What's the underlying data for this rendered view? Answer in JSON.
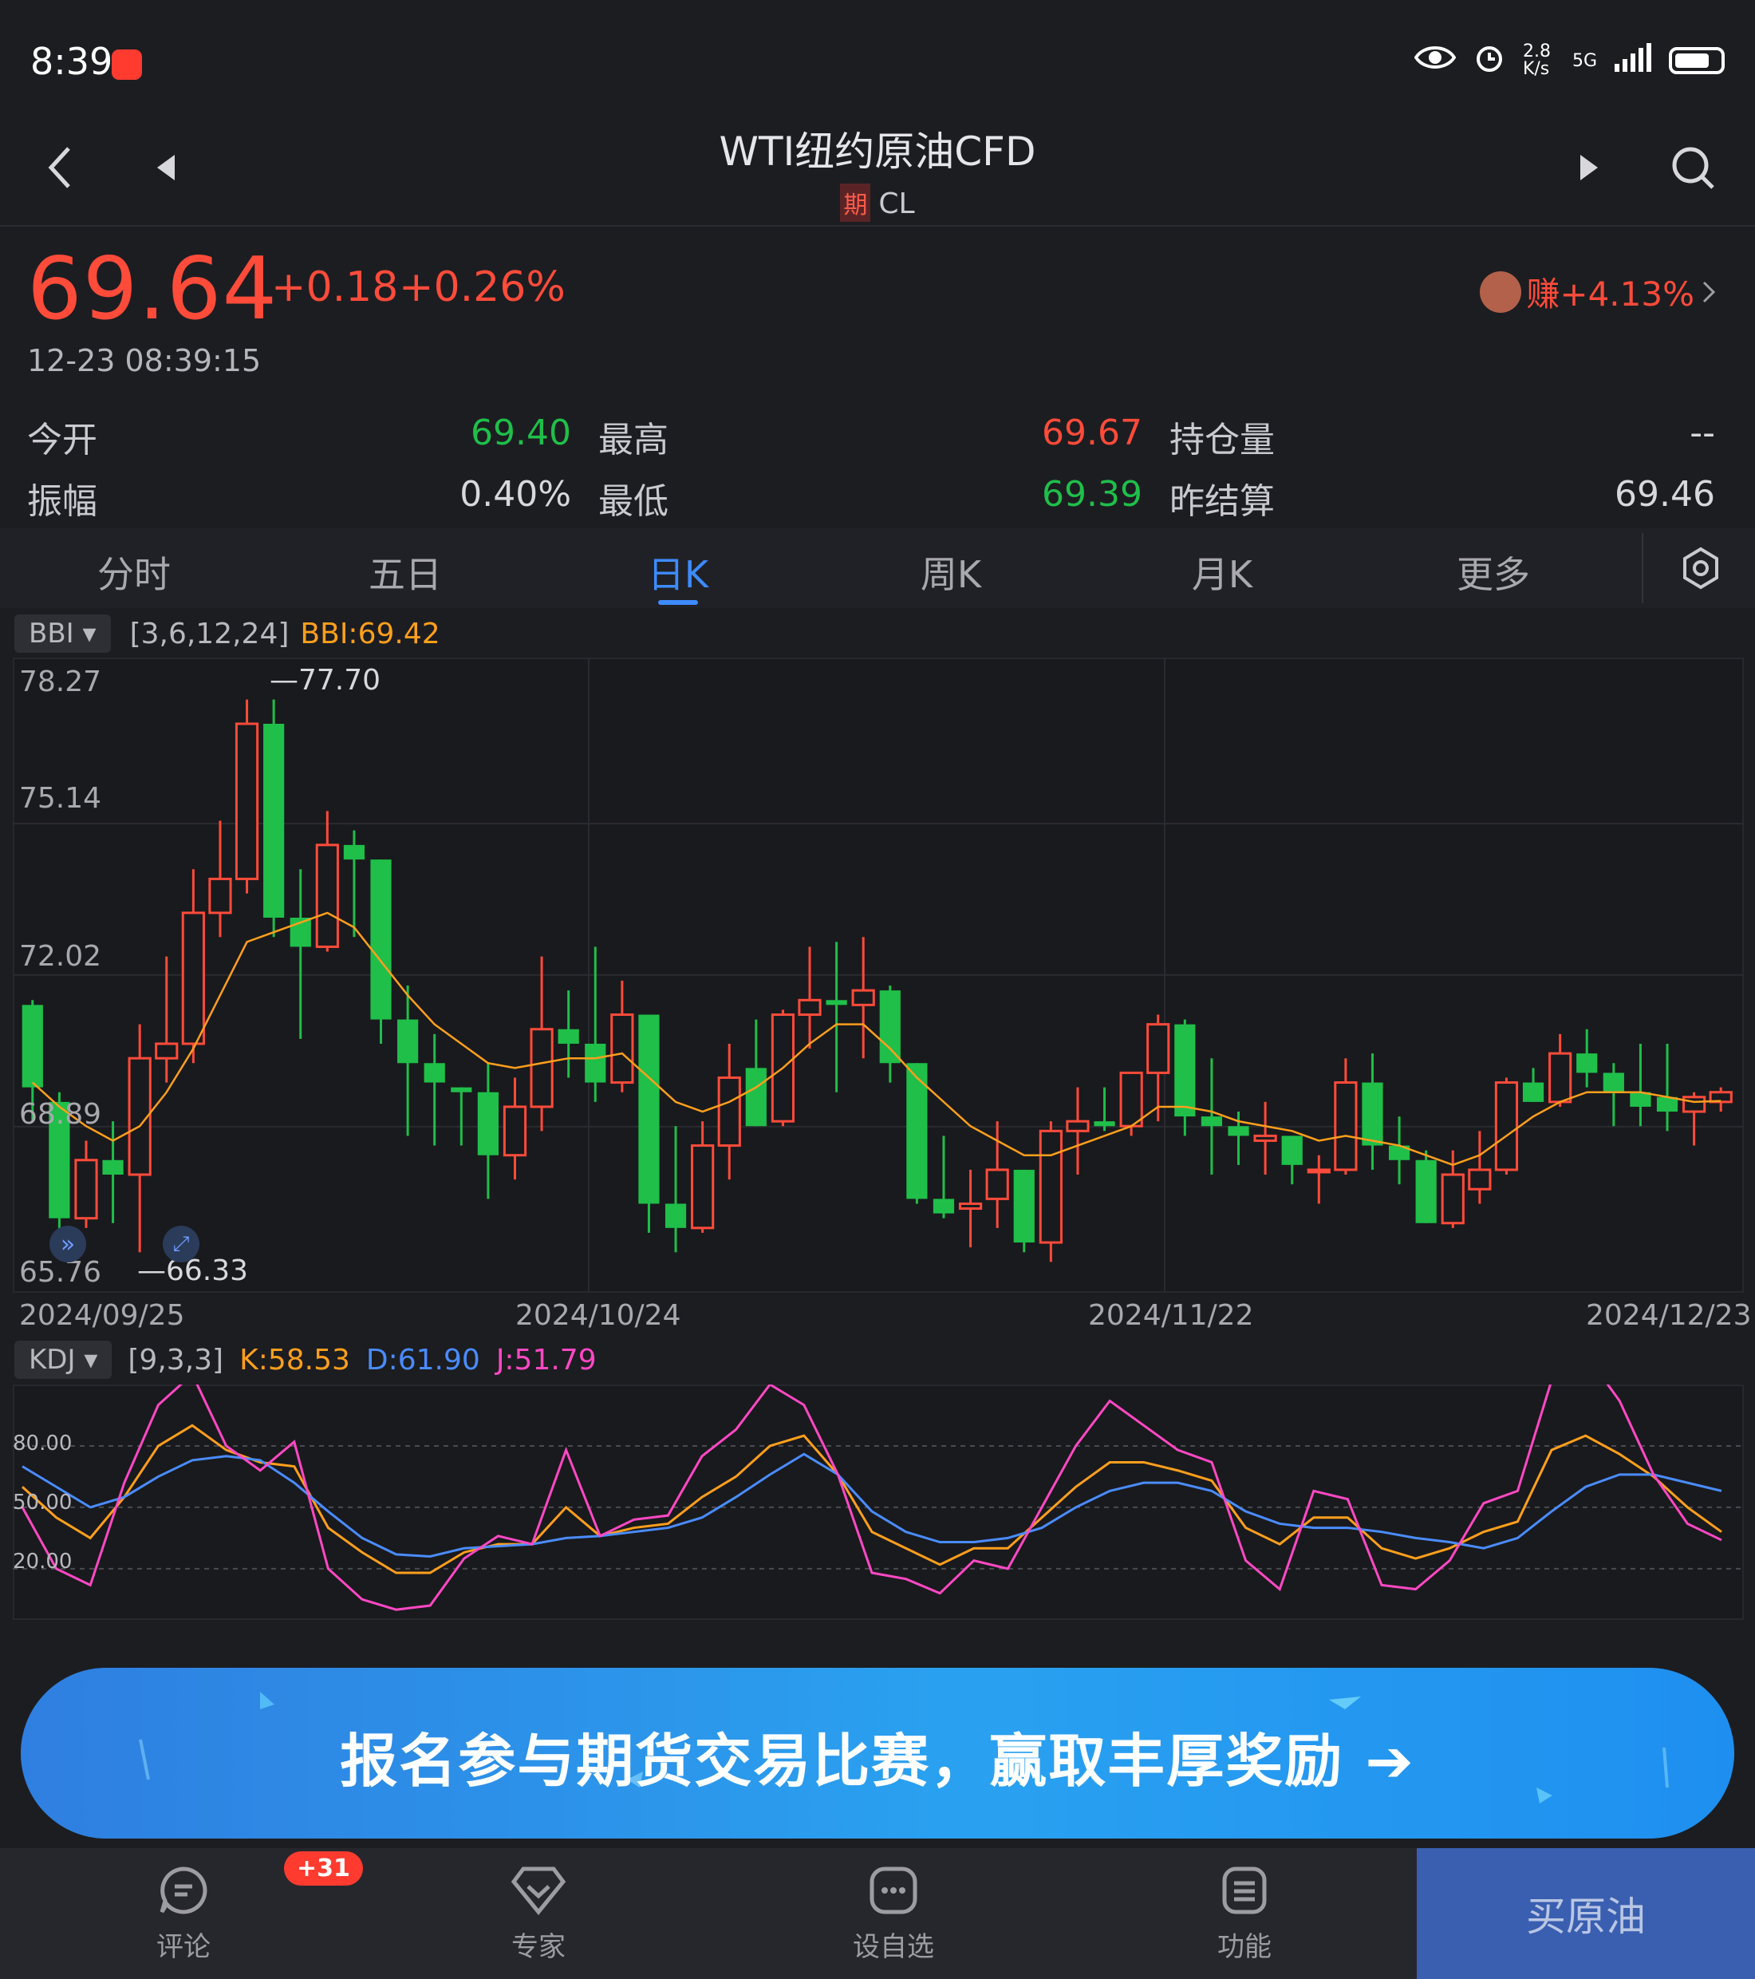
{
  "status_bar": {
    "time": "8:39",
    "net_speed": "2.8 K/s",
    "signal": "5G"
  },
  "nav": {
    "title": "WTI纽约原油CFD",
    "tag": "期",
    "code": "CL"
  },
  "quote": {
    "price": "69.64",
    "change": "+0.18",
    "change_pct": "+0.26%",
    "timestamp": "12-23 08:39:15",
    "earn": "赚+4.13%",
    "up_color": "#ff4b3a",
    "down_color": "#1fbf4a"
  },
  "stats": {
    "open_label": "今开",
    "open": "69.40",
    "high_label": "最高",
    "high": "69.67",
    "oi_label": "持仓量",
    "oi": "--",
    "amp_label": "振幅",
    "amp": "0.40%",
    "low_label": "最低",
    "low": "69.39",
    "prev_label": "昨结算",
    "prev": "69.46"
  },
  "tabs": [
    "分时",
    "五日",
    "日K",
    "周K",
    "月K",
    "更多"
  ],
  "main_indicator": {
    "name": "BBI",
    "params": "[3,6,12,24]",
    "value": "BBI:69.42"
  },
  "kdj_indicator": {
    "name": "KDJ",
    "params": "[9,3,3]",
    "k": "K:58.53",
    "d": "D:61.90",
    "j": "J:51.79"
  },
  "chart_data": [
    {
      "type": "candlestick",
      "title": "",
      "ylim": [
        65.76,
        78.27
      ],
      "y_ticks": [
        "78.27",
        "75.14",
        "72.02",
        "68.89",
        "65.76"
      ],
      "x_ticks": [
        "2024/09/25",
        "2024/10/24",
        "2024/11/22",
        "2024/12/23"
      ],
      "max_label": "77.70",
      "min_label": "66.33",
      "candles": [
        {
          "o": 71.4,
          "h": 71.5,
          "l": 69.0,
          "c": 69.7
        },
        {
          "o": 69.4,
          "h": 69.6,
          "l": 66.7,
          "c": 67.0
        },
        {
          "o": 67.0,
          "h": 68.6,
          "l": 66.8,
          "c": 68.2
        },
        {
          "o": 68.2,
          "h": 69.0,
          "l": 66.9,
          "c": 67.9
        },
        {
          "o": 67.9,
          "h": 71.0,
          "l": 66.3,
          "c": 70.3
        },
        {
          "o": 70.3,
          "h": 72.4,
          "l": 69.8,
          "c": 70.6
        },
        {
          "o": 70.6,
          "h": 74.2,
          "l": 70.2,
          "c": 73.3
        },
        {
          "o": 73.3,
          "h": 75.2,
          "l": 72.8,
          "c": 74.0
        },
        {
          "o": 74.0,
          "h": 77.7,
          "l": 73.7,
          "c": 77.2
        },
        {
          "o": 77.2,
          "h": 77.7,
          "l": 72.8,
          "c": 73.2
        },
        {
          "o": 73.2,
          "h": 74.2,
          "l": 70.7,
          "c": 72.6
        },
        {
          "o": 72.6,
          "h": 75.4,
          "l": 72.5,
          "c": 74.7
        },
        {
          "o": 74.7,
          "h": 75.0,
          "l": 72.8,
          "c": 74.4
        },
        {
          "o": 74.4,
          "h": 74.4,
          "l": 70.6,
          "c": 71.1
        },
        {
          "o": 71.1,
          "h": 71.8,
          "l": 68.7,
          "c": 70.2
        },
        {
          "o": 70.2,
          "h": 70.8,
          "l": 68.5,
          "c": 69.8
        },
        {
          "o": 69.7,
          "h": 69.7,
          "l": 68.5,
          "c": 69.6
        },
        {
          "o": 69.6,
          "h": 70.2,
          "l": 67.4,
          "c": 68.3
        },
        {
          "o": 68.3,
          "h": 69.9,
          "l": 67.8,
          "c": 69.3
        },
        {
          "o": 69.3,
          "h": 72.4,
          "l": 68.8,
          "c": 70.9
        },
        {
          "o": 70.9,
          "h": 71.7,
          "l": 69.9,
          "c": 70.6
        },
        {
          "o": 70.6,
          "h": 72.6,
          "l": 69.4,
          "c": 69.8
        },
        {
          "o": 69.8,
          "h": 71.9,
          "l": 69.6,
          "c": 71.2
        },
        {
          "o": 71.2,
          "h": 71.2,
          "l": 66.7,
          "c": 67.3
        },
        {
          "o": 67.3,
          "h": 68.9,
          "l": 66.3,
          "c": 66.8
        },
        {
          "o": 66.8,
          "h": 69.0,
          "l": 66.7,
          "c": 68.5
        },
        {
          "o": 68.5,
          "h": 70.6,
          "l": 67.8,
          "c": 69.9
        },
        {
          "o": 70.1,
          "h": 71.1,
          "l": 68.9,
          "c": 68.9
        },
        {
          "o": 69.0,
          "h": 71.3,
          "l": 68.9,
          "c": 71.2
        },
        {
          "o": 71.2,
          "h": 72.6,
          "l": 70.5,
          "c": 71.5
        },
        {
          "o": 71.5,
          "h": 72.7,
          "l": 69.6,
          "c": 71.4
        },
        {
          "o": 71.4,
          "h": 72.8,
          "l": 70.3,
          "c": 71.7
        },
        {
          "o": 71.7,
          "h": 71.8,
          "l": 69.8,
          "c": 70.2
        },
        {
          "o": 70.2,
          "h": 70.2,
          "l": 67.3,
          "c": 67.4
        },
        {
          "o": 67.4,
          "h": 68.7,
          "l": 67.0,
          "c": 67.1
        },
        {
          "o": 67.2,
          "h": 68.0,
          "l": 66.4,
          "c": 67.3
        },
        {
          "o": 67.4,
          "h": 69.0,
          "l": 66.8,
          "c": 68.0
        },
        {
          "o": 68.0,
          "h": 68.0,
          "l": 66.3,
          "c": 66.5
        },
        {
          "o": 66.5,
          "h": 69.0,
          "l": 66.1,
          "c": 68.8
        },
        {
          "o": 68.8,
          "h": 69.7,
          "l": 67.9,
          "c": 69.0
        },
        {
          "o": 69.0,
          "h": 69.7,
          "l": 68.8,
          "c": 68.9
        },
        {
          "o": 68.9,
          "h": 70.0,
          "l": 68.7,
          "c": 70.0
        },
        {
          "o": 70.0,
          "h": 71.2,
          "l": 69.0,
          "c": 71.0
        },
        {
          "o": 71.0,
          "h": 71.1,
          "l": 68.7,
          "c": 69.1
        },
        {
          "o": 69.1,
          "h": 70.3,
          "l": 67.9,
          "c": 68.9
        },
        {
          "o": 68.9,
          "h": 69.2,
          "l": 68.1,
          "c": 68.7
        },
        {
          "o": 68.6,
          "h": 69.4,
          "l": 67.9,
          "c": 68.7
        },
        {
          "o": 68.7,
          "h": 68.7,
          "l": 67.7,
          "c": 68.1
        },
        {
          "o": 68.0,
          "h": 68.3,
          "l": 67.3,
          "c": 68.0
        },
        {
          "o": 68.0,
          "h": 70.3,
          "l": 67.9,
          "c": 69.8
        },
        {
          "o": 69.8,
          "h": 70.4,
          "l": 68.0,
          "c": 68.5
        },
        {
          "o": 68.5,
          "h": 69.1,
          "l": 67.7,
          "c": 68.2
        },
        {
          "o": 68.2,
          "h": 68.4,
          "l": 66.9,
          "c": 66.9
        },
        {
          "o": 66.9,
          "h": 68.4,
          "l": 66.8,
          "c": 67.9
        },
        {
          "o": 67.6,
          "h": 68.8,
          "l": 67.3,
          "c": 68.0
        },
        {
          "o": 68.0,
          "h": 69.9,
          "l": 67.9,
          "c": 69.8
        },
        {
          "o": 69.8,
          "h": 70.1,
          "l": 69.4,
          "c": 69.4
        },
        {
          "o": 69.4,
          "h": 70.8,
          "l": 69.3,
          "c": 70.4
        },
        {
          "o": 70.4,
          "h": 70.9,
          "l": 69.7,
          "c": 70.0
        },
        {
          "o": 70.0,
          "h": 70.2,
          "l": 68.9,
          "c": 69.6
        },
        {
          "o": 69.6,
          "h": 70.6,
          "l": 68.9,
          "c": 69.3
        },
        {
          "o": 69.5,
          "h": 70.6,
          "l": 68.8,
          "c": 69.2
        },
        {
          "o": 69.2,
          "h": 69.6,
          "l": 68.5,
          "c": 69.5
        },
        {
          "o": 69.4,
          "h": 69.7,
          "l": 69.2,
          "c": 69.6
        }
      ],
      "bbi": [
        69.8,
        69.3,
        68.9,
        68.6,
        68.9,
        69.6,
        70.5,
        71.6,
        72.7,
        72.9,
        73.1,
        73.3,
        73.0,
        72.3,
        71.6,
        71.0,
        70.6,
        70.2,
        70.1,
        70.2,
        70.3,
        70.3,
        70.4,
        69.9,
        69.4,
        69.2,
        69.4,
        69.7,
        70.1,
        70.6,
        71.0,
        71.0,
        70.5,
        69.9,
        69.4,
        68.9,
        68.6,
        68.3,
        68.3,
        68.5,
        68.7,
        68.9,
        69.3,
        69.3,
        69.2,
        69.0,
        68.9,
        68.8,
        68.6,
        68.7,
        68.6,
        68.5,
        68.3,
        68.1,
        68.3,
        68.7,
        69.1,
        69.4,
        69.6,
        69.6,
        69.6,
        69.5,
        69.4,
        69.42
      ]
    },
    {
      "type": "line",
      "title": "",
      "ylim": [
        -5,
        110
      ],
      "y_ticks": [
        "80.00",
        "50.00",
        "20.00"
      ],
      "series": [
        {
          "name": "K",
          "color": "#ff9f1c",
          "values": [
            60,
            45,
            35,
            55,
            80,
            90,
            78,
            72,
            70,
            40,
            28,
            18,
            18,
            28,
            32,
            32,
            50,
            36,
            40,
            42,
            55,
            65,
            80,
            85,
            66,
            38,
            30,
            22,
            30,
            30,
            45,
            60,
            72,
            72,
            68,
            63,
            40,
            32,
            45,
            45,
            30,
            25,
            30,
            38,
            43,
            78,
            85,
            76,
            65,
            50,
            38
          ]
        },
        {
          "name": "D",
          "color": "#4a8cff",
          "values": [
            70,
            60,
            50,
            55,
            65,
            73,
            75,
            73,
            62,
            48,
            35,
            27,
            26,
            30,
            31,
            32,
            35,
            36,
            38,
            40,
            45,
            55,
            66,
            76,
            66,
            48,
            38,
            33,
            33,
            35,
            40,
            50,
            58,
            62,
            62,
            58,
            48,
            42,
            40,
            40,
            38,
            35,
            33,
            30,
            35,
            48,
            60,
            66,
            66,
            62,
            58
          ]
        },
        {
          "name": "J",
          "color": "#ff48c4",
          "values": [
            50,
            20,
            12,
            62,
            100,
            115,
            80,
            68,
            82,
            20,
            5,
            0,
            2,
            25,
            36,
            32,
            78,
            36,
            44,
            46,
            75,
            88,
            110,
            100,
            66,
            18,
            15,
            8,
            24,
            20,
            50,
            80,
            102,
            90,
            78,
            72,
            24,
            10,
            58,
            54,
            12,
            10,
            24,
            52,
            58,
            112,
            125,
            102,
            66,
            42,
            34
          ]
        }
      ]
    }
  ],
  "banner": {
    "text": "报名参与期货交易比赛，赢取丰厚奖励"
  },
  "bottom_nav": {
    "comment": "评论",
    "badge": "+31",
    "expert": "专家",
    "watch": "设自选",
    "func": "功能",
    "buy": "买原油"
  }
}
